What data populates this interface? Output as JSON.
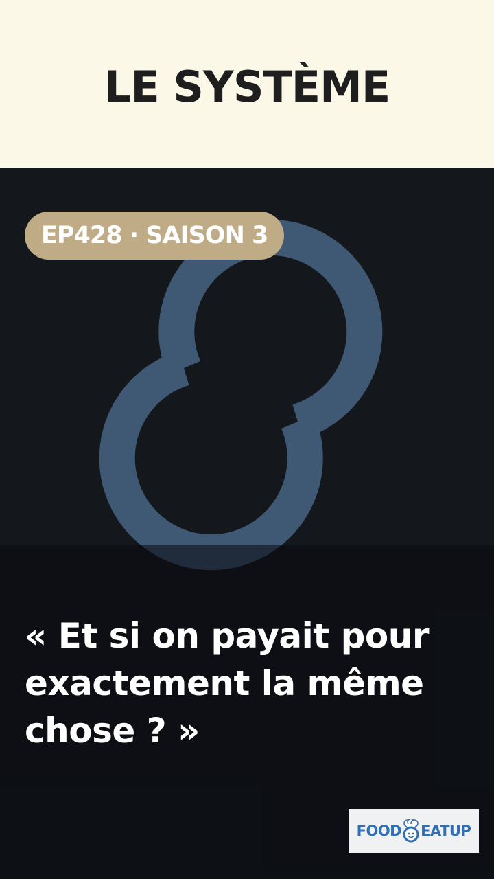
{
  "header": {
    "title": "LE SYSTÈME"
  },
  "badge": {
    "text": "EP428 · SAISON 3"
  },
  "quote": {
    "text": "« Et si on payait pour exactement la même chose ? »"
  },
  "brand": {
    "left": "FOOD",
    "right": "EATUP",
    "icon": "chef-hat-icon"
  },
  "colors": {
    "header_bg": "#fbf8e8",
    "stage_bg": "#14181d",
    "eight_stroke": "#3f5873",
    "badge_bg": "#bfab86",
    "brand_blue": "#2f6fb5"
  }
}
